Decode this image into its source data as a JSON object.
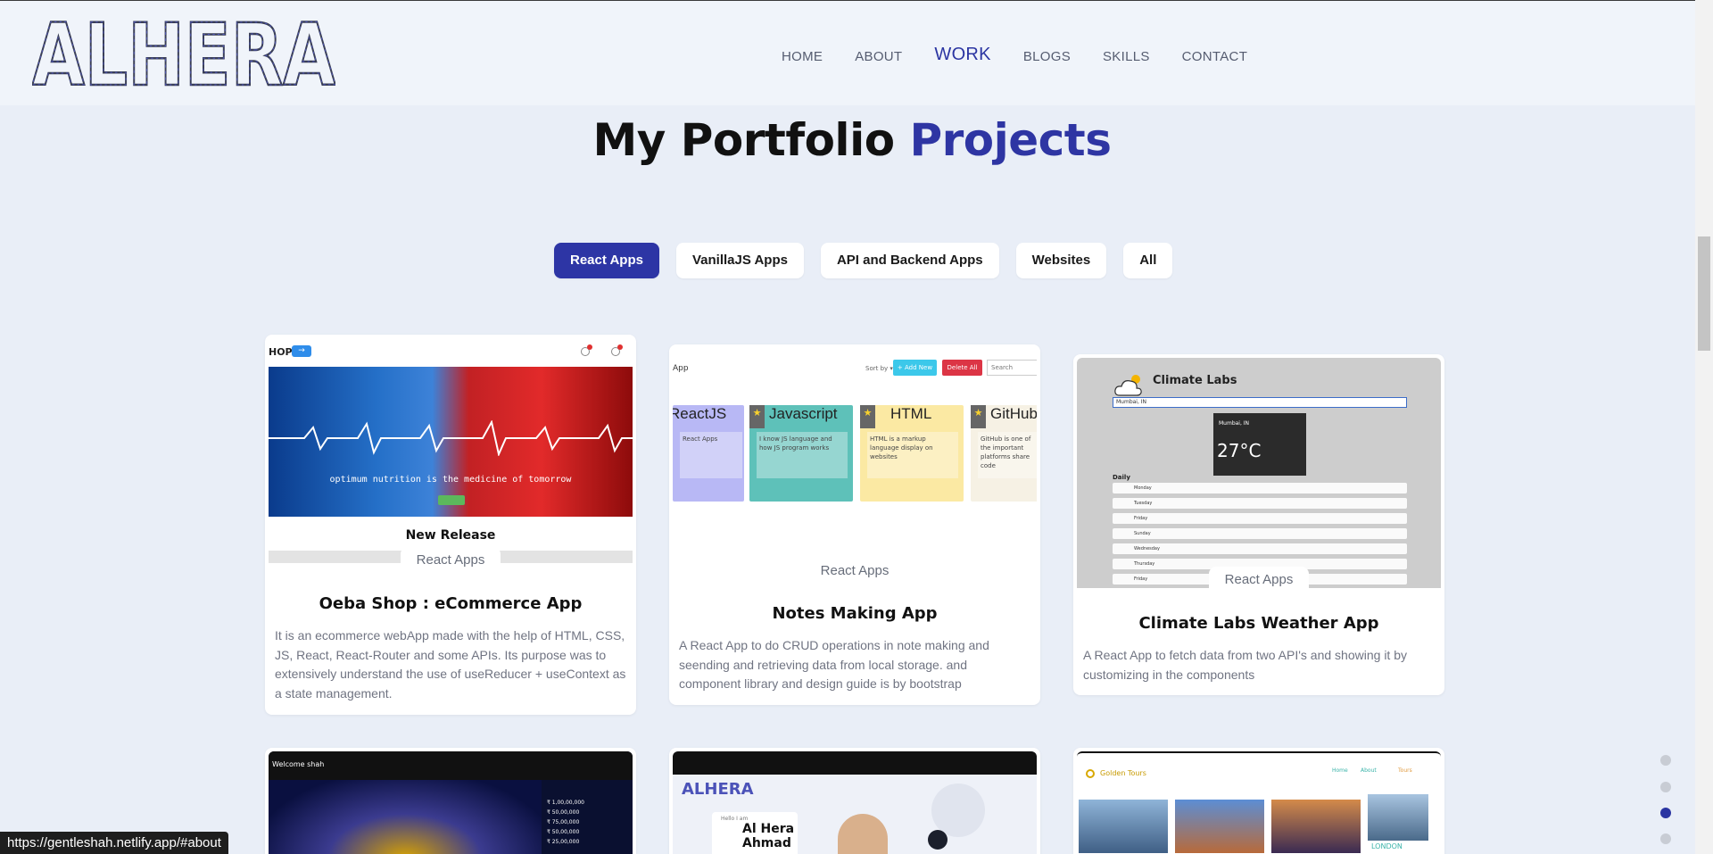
{
  "brand": {
    "logo_text": "ALHERA"
  },
  "nav": {
    "items": [
      {
        "label": "HOME",
        "active": false
      },
      {
        "label": "ABOUT",
        "active": false
      },
      {
        "label": "WORK",
        "active": true
      },
      {
        "label": "BLOGS",
        "active": false
      },
      {
        "label": "SKILLS",
        "active": false
      },
      {
        "label": "CONTACT",
        "active": false
      }
    ]
  },
  "title": {
    "part1": "My Portfolio ",
    "part2": "Projects"
  },
  "filters": [
    {
      "label": "React Apps",
      "active": true
    },
    {
      "label": "VanillaJS Apps",
      "active": false
    },
    {
      "label": "API and Backend Apps",
      "active": false
    },
    {
      "label": "Websites",
      "active": false
    },
    {
      "label": "All",
      "active": false
    }
  ],
  "projects": [
    {
      "category": "React Apps",
      "title": "Oeba Shop : eCommerce App",
      "description": "It is an ecommerce webApp made with the help of HTML, CSS, JS, React, React-Router and some APIs. Its purpose was to extensively understand the use of useReducer + useContext as a state management.",
      "thumb": {
        "shop_text": "HOP",
        "hero_text": "optimum nutrition is the medicine of tomorrow",
        "section_label": "New Release"
      }
    },
    {
      "category": "React Apps",
      "title": "Notes Making App",
      "description": "A React App to do CRUD operations in note making and seending and retrieving data from local storage. and component library and design guide is by bootstrap",
      "thumb": {
        "app_label": "App",
        "sort_label": "Sort by ▾",
        "add_label": "+ Add New",
        "delete_label": "Delete All",
        "search_placeholder": "Search",
        "notes": [
          {
            "title": "ReactJS",
            "body": "React Apps",
            "color": "#b8b8f5"
          },
          {
            "title": "Javascript",
            "body": "I know JS language and how JS program works",
            "color": "#5ec1b9"
          },
          {
            "title": "HTML",
            "body": "HTML is a markup language display on websites",
            "color": "#fbe9a3"
          },
          {
            "title": "GitHub",
            "body": "GitHub is one of the important platforms share code",
            "color": "#f6f1e4"
          }
        ]
      }
    },
    {
      "category": "React Apps",
      "title": "Climate Labs Weather App",
      "description": "A React App to fetch data from two API's and showing it by customizing in the components",
      "thumb": {
        "app_title": "Climate Labs",
        "select_value": "Mumbai, IN",
        "city": "Mumbai, IN",
        "temp": "27°C",
        "daily_label": "Daily",
        "days": [
          "Monday",
          "Tuesday",
          "Friday",
          "Sunday",
          "Wednesday",
          "Thursday",
          "Friday"
        ]
      }
    }
  ],
  "bottom_previews": [
    {
      "label": "Welcome shah",
      "amounts": [
        "₹ 1,00,00,000",
        "₹ 50,00,000",
        "₹ 75,00,000",
        "₹ 50,00,000",
        "₹ 25,00,000"
      ]
    },
    {
      "logo": "ALHERA",
      "hello": "Hello I am",
      "name": "Al Hera Ahmad"
    },
    {
      "brand": "Golden Tours",
      "links": [
        "Home",
        "About",
        "Tours"
      ],
      "city": "LONDON"
    }
  ],
  "status_url": "https://gentleshah.netlify.app/#about"
}
